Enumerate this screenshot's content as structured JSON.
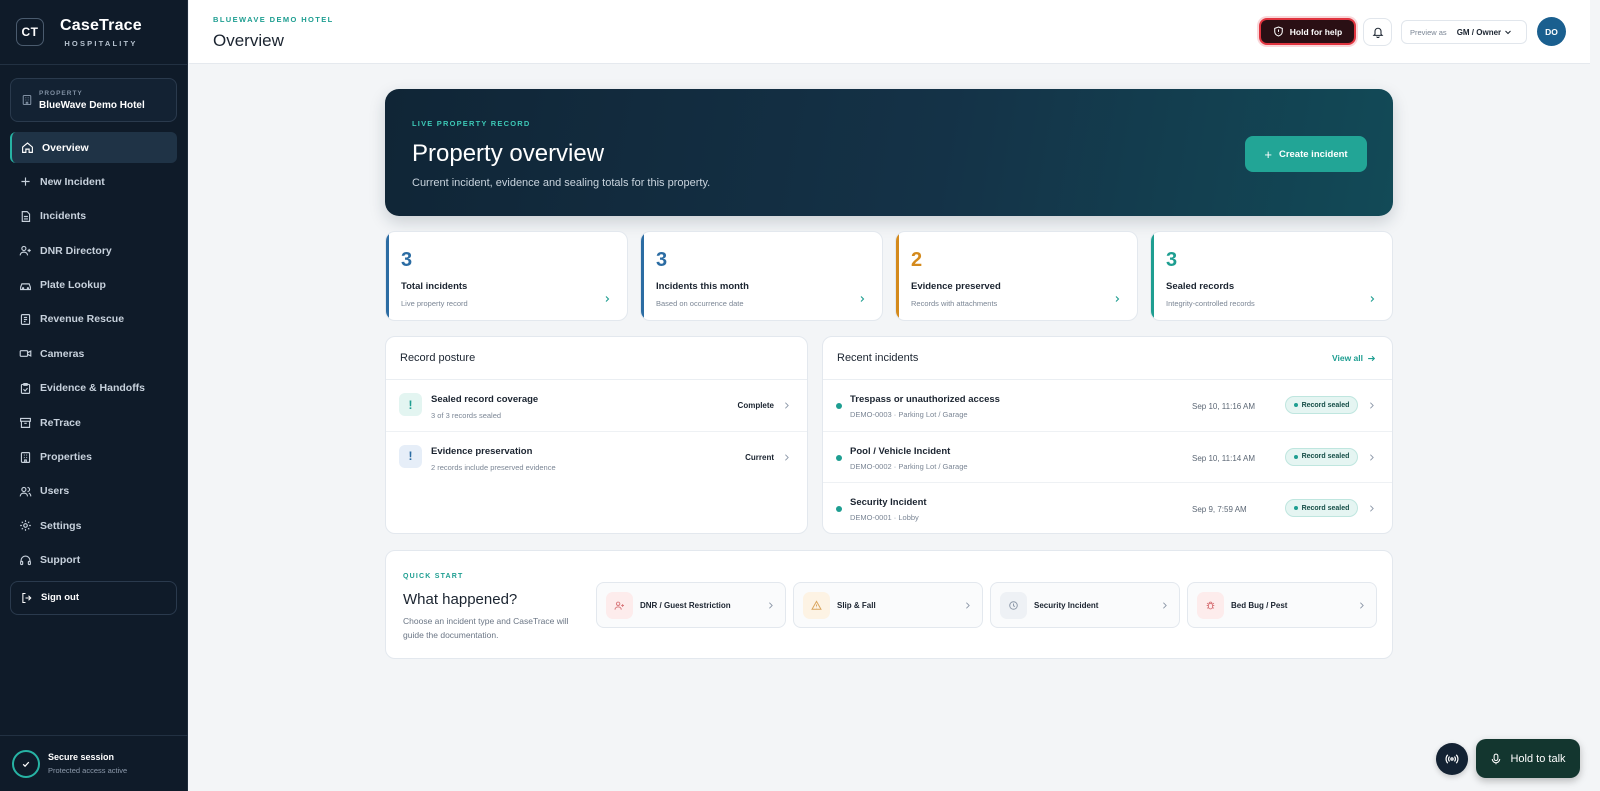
{
  "brand": {
    "logo": "CT",
    "name": "CaseTrace",
    "sub": "HOSPITALITY"
  },
  "property": {
    "label": "PROPERTY",
    "value": "BlueWave Demo Hotel"
  },
  "nav": [
    {
      "label": "Overview",
      "icon": "home-icon",
      "active": true
    },
    {
      "label": "New Incident",
      "icon": "plus-icon"
    },
    {
      "label": "Incidents",
      "icon": "document-icon"
    },
    {
      "label": "DNR Directory",
      "icon": "user-plus-icon"
    },
    {
      "label": "Plate Lookup",
      "icon": "car-icon"
    },
    {
      "label": "Revenue Rescue",
      "icon": "receipt-icon"
    },
    {
      "label": "Cameras",
      "icon": "camera-icon"
    },
    {
      "label": "Evidence & Handoffs",
      "icon": "clipboard-check-icon"
    },
    {
      "label": "ReTrace",
      "icon": "archive-icon"
    },
    {
      "label": "Properties",
      "icon": "building-icon"
    },
    {
      "label": "Users",
      "icon": "users-icon"
    },
    {
      "label": "Settings",
      "icon": "gear-icon"
    },
    {
      "label": "Support",
      "icon": "headset-icon"
    }
  ],
  "signout": "Sign out",
  "session": {
    "title": "Secure session",
    "sub": "Protected access active"
  },
  "header": {
    "crumb": "BLUEWAVE DEMO HOTEL",
    "title": "Overview",
    "hold_help": "Hold for help",
    "preview_label": "Preview as",
    "preview_value": "GM / Owner",
    "avatar": "DO"
  },
  "hero": {
    "kicker": "LIVE PROPERTY RECORD",
    "title": "Property overview",
    "sub": "Current incident, evidence and sealing totals for this property.",
    "button": "Create incident"
  },
  "stats": [
    {
      "value": "3",
      "label": "Total incidents",
      "sub": "Live property record",
      "color": "#2b6ca3"
    },
    {
      "value": "3",
      "label": "Incidents this month",
      "sub": "Based on occurrence date",
      "color": "#2b6ca3"
    },
    {
      "value": "2",
      "label": "Evidence preserved",
      "sub": "Records with attachments",
      "color": "#d48a1c"
    },
    {
      "value": "3",
      "label": "Sealed records",
      "sub": "Integrity-controlled records",
      "color": "#1e9e91"
    }
  ],
  "posture": {
    "title": "Record posture",
    "items": [
      {
        "title": "Sealed record coverage",
        "sub": "3 of 3 records sealed",
        "status": "Complete",
        "icon": "!"
      },
      {
        "title": "Evidence preservation",
        "sub": "2 records include preserved evidence",
        "status": "Current",
        "icon": "!"
      }
    ]
  },
  "recent": {
    "title": "Recent incidents",
    "view_all": "View all",
    "items": [
      {
        "title": "Trespass or unauthorized access",
        "sub": "DEMO-0003 · Parking Lot / Garage",
        "time": "Sep 10, 11:16 AM",
        "badge": "Record sealed"
      },
      {
        "title": "Pool / Vehicle Incident",
        "sub": "DEMO-0002 · Parking Lot / Garage",
        "time": "Sep 10, 11:14 AM",
        "badge": "Record sealed"
      },
      {
        "title": "Security Incident",
        "sub": "DEMO-0001 · Lobby",
        "time": "Sep 9, 7:59 AM",
        "badge": "Record sealed"
      }
    ]
  },
  "quickstart": {
    "kicker": "QUICK START",
    "title": "What happened?",
    "desc": "Choose an incident type and CaseTrace will guide the documentation.",
    "cards": [
      {
        "label": "DNR / Guest Restriction",
        "icon": "user-plus-icon",
        "bg": "#fdecec",
        "fg": "#d9787c"
      },
      {
        "label": "Slip & Fall",
        "icon": "warning-icon",
        "bg": "#fdf3e4",
        "fg": "#d9a45c"
      },
      {
        "label": "Security Incident",
        "icon": "clock-icon",
        "bg": "#eef1f5",
        "fg": "#8c98a8"
      },
      {
        "label": "Bed Bug / Pest",
        "icon": "bug-icon",
        "bg": "#fdecec",
        "fg": "#d9787c"
      }
    ]
  },
  "floating": {
    "talk": "Hold to talk"
  }
}
